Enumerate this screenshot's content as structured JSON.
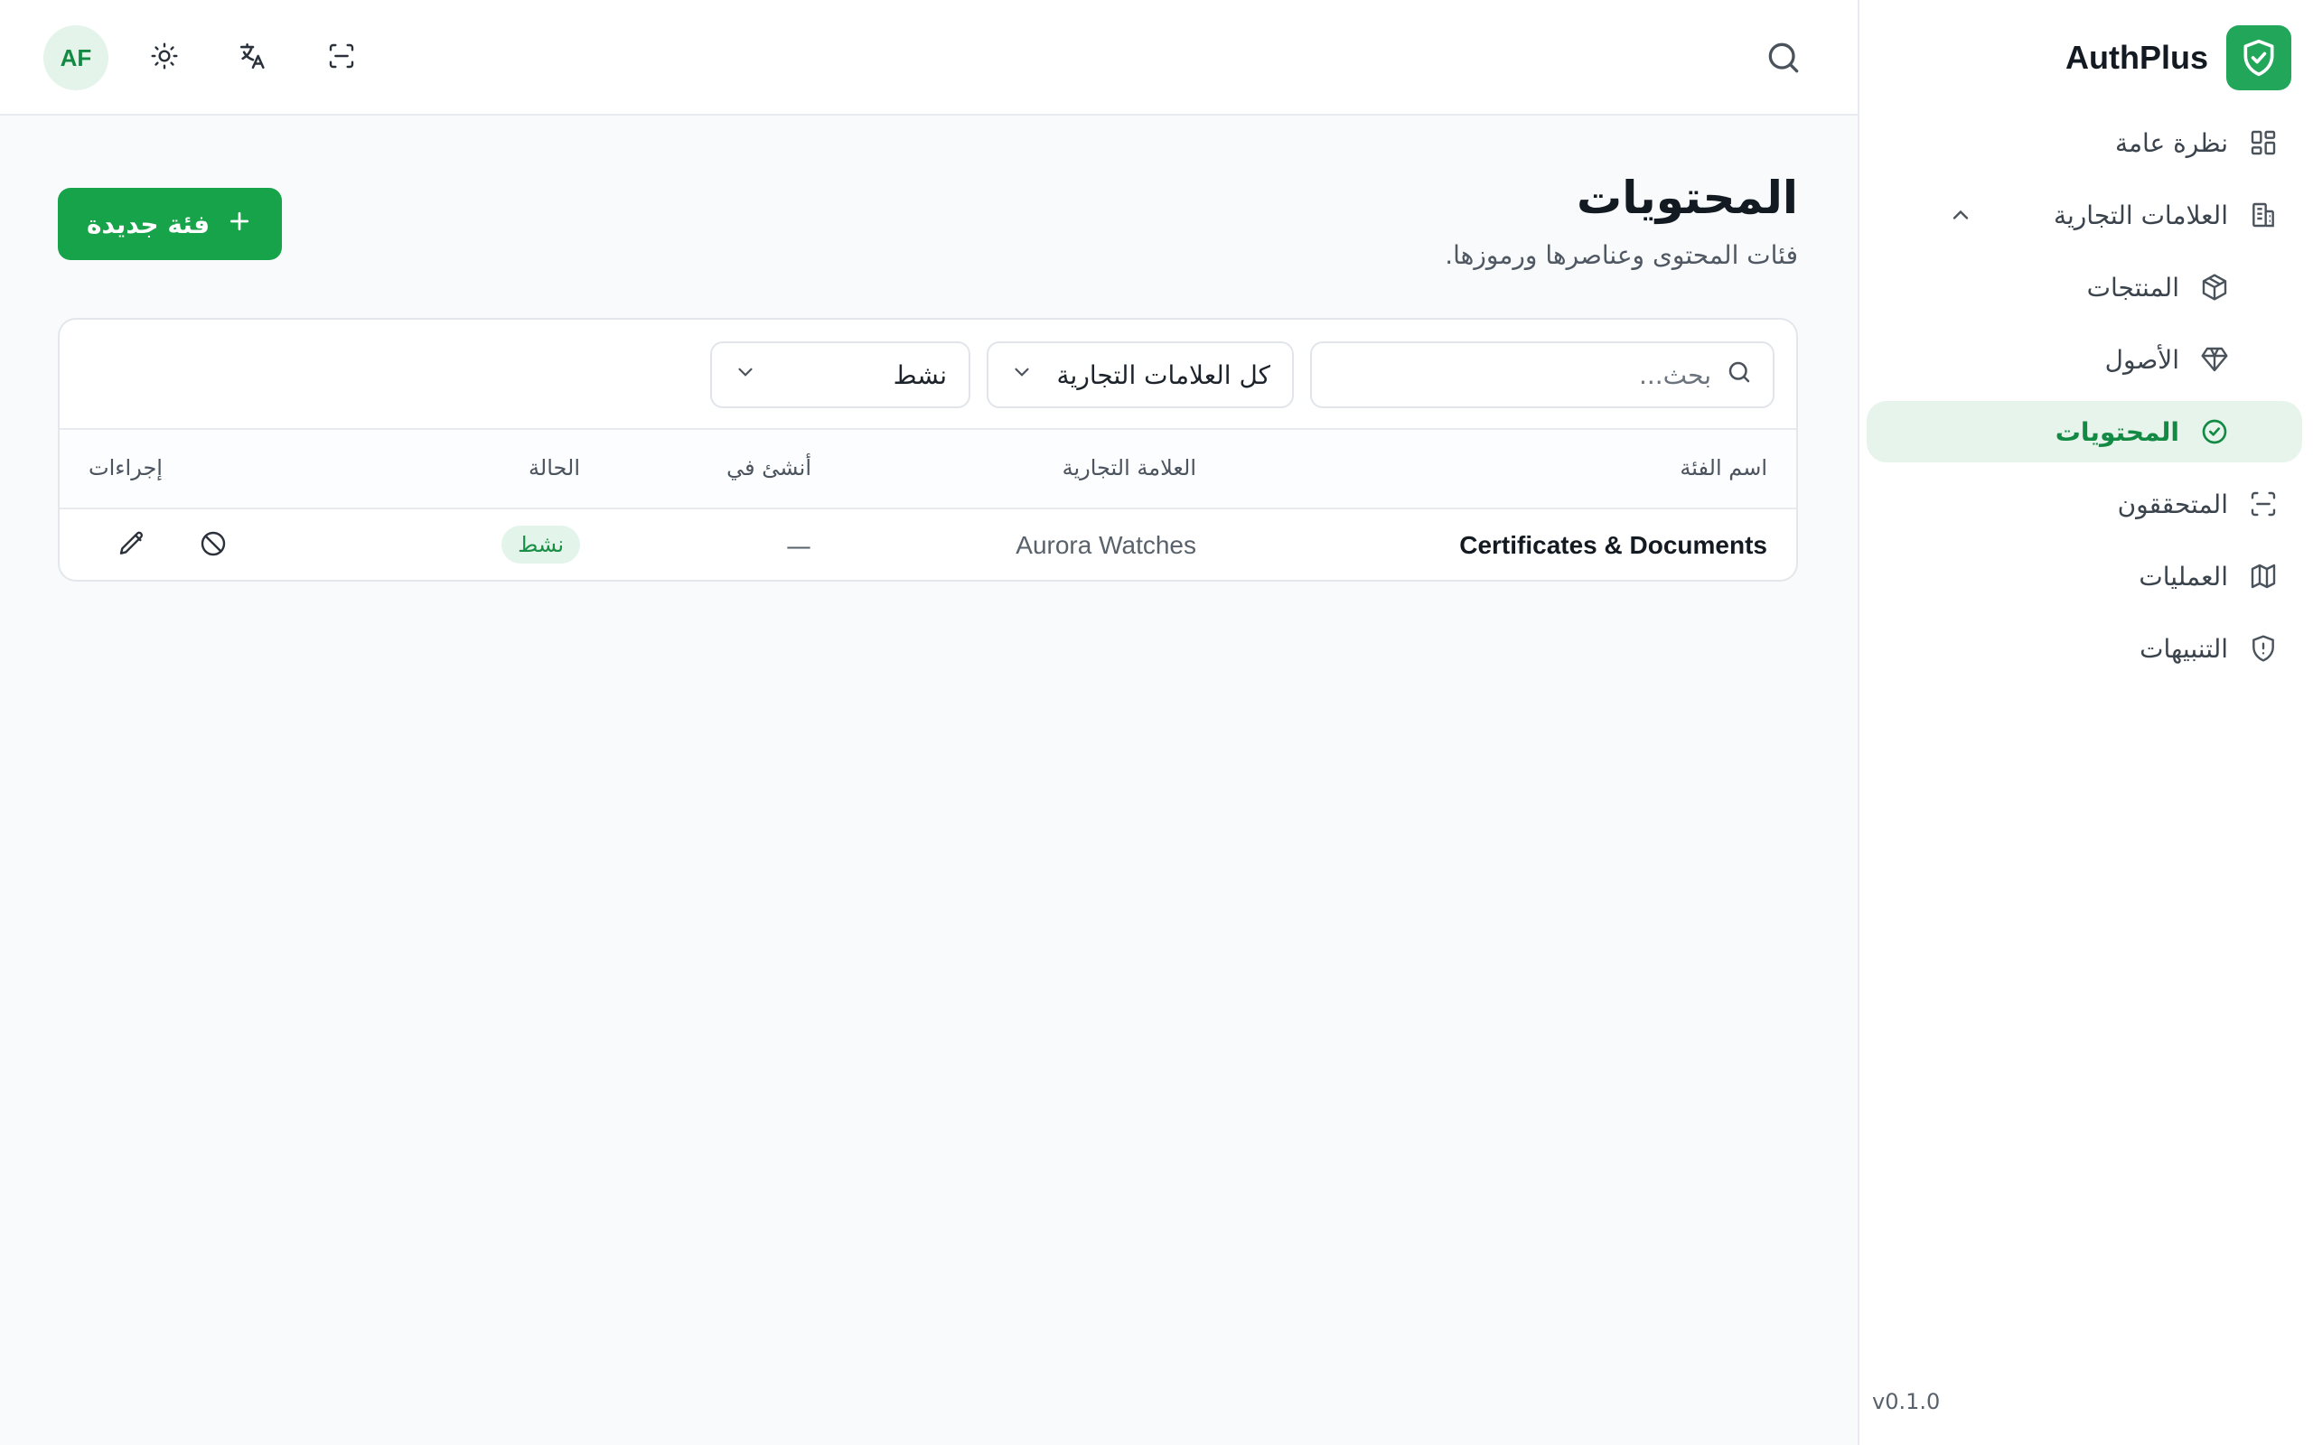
{
  "app": {
    "name": "AuthPlus",
    "version": "v0.1.0"
  },
  "header": {
    "avatar_initials": "AF"
  },
  "sidebar": {
    "items": [
      {
        "label": "نظرة عامة",
        "icon": "dashboard-grid-icon"
      },
      {
        "label": "العلامات التجارية",
        "icon": "building-icon",
        "expanded": true
      },
      {
        "label": "المنتجات",
        "icon": "package-icon"
      },
      {
        "label": "الأصول",
        "icon": "gem-icon"
      },
      {
        "label": "المحتويات",
        "icon": "check-circle-icon",
        "active": true
      },
      {
        "label": "المتحققون",
        "icon": "scan-icon"
      },
      {
        "label": "العمليات",
        "icon": "map-icon"
      },
      {
        "label": "التنبيهات",
        "icon": "shield-alert-icon"
      }
    ]
  },
  "page": {
    "title": "المحتويات",
    "subtitle": "فئات المحتوى وعناصرها ورموزها.",
    "new_button_label": "فئة جديدة"
  },
  "filters": {
    "search_placeholder": "بحث...",
    "brand_select": "كل العلامات التجارية",
    "status_select": "نشط"
  },
  "table": {
    "columns": [
      "اسم الفئة",
      "العلامة التجارية",
      "أنشئ في",
      "الحالة",
      "إجراءات"
    ],
    "rows": [
      {
        "name": "Certificates & Documents",
        "brand": "Aurora Watches",
        "created": "—",
        "status": "نشط"
      }
    ]
  },
  "colors": {
    "accent": "#16a34a",
    "active_bg": "#e6f4ec",
    "badge_bg": "#e3f4ea"
  }
}
